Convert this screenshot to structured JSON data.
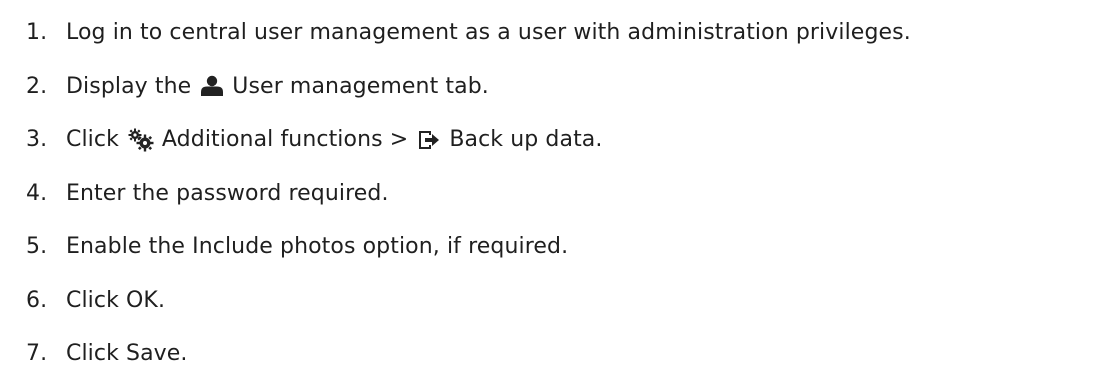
{
  "steps": [
    {
      "number": "1.",
      "text": "Log in to central user management as a user with administration privileges."
    },
    {
      "number": "2.",
      "before": "Display the",
      "icon": "user-icon",
      "after": "User management tab."
    },
    {
      "number": "3.",
      "before": "Click",
      "icon": "gears-icon",
      "middle": "Additional functions >",
      "icon2": "export-icon",
      "after": "Back up data."
    },
    {
      "number": "4.",
      "text": "Enter the password required."
    },
    {
      "number": "5.",
      "text": "Enable the Include photos option, if required."
    },
    {
      "number": "6.",
      "text": "Click OK."
    },
    {
      "number": "7.",
      "text": "Click Save."
    }
  ],
  "colors": {
    "text": "#1f1f1f",
    "icon": "#222222"
  }
}
